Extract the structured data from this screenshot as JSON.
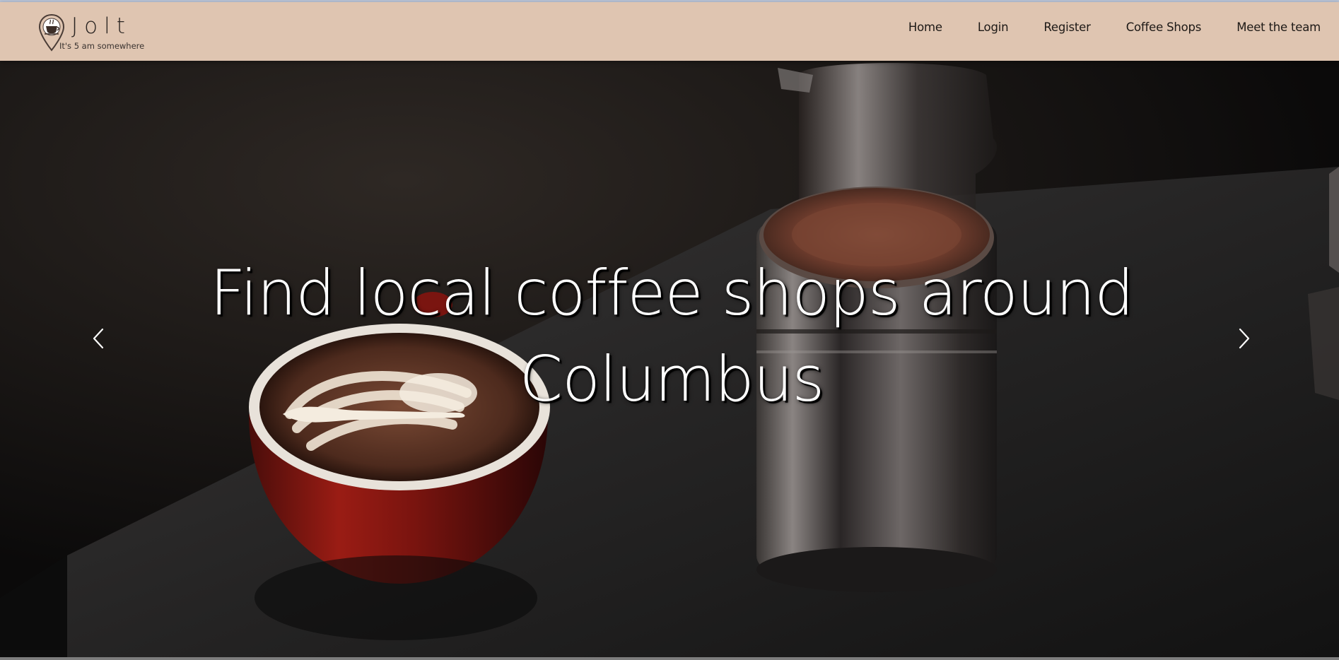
{
  "brand": {
    "name": "Jolt",
    "tagline": "It's 5 am somewhere",
    "logo_icon": "map-pin-coffee-cup-icon"
  },
  "nav": {
    "items": [
      {
        "label": "Home"
      },
      {
        "label": "Login"
      },
      {
        "label": "Register"
      },
      {
        "label": "Coffee Shops"
      },
      {
        "label": "Meet the team"
      }
    ]
  },
  "hero": {
    "headline_line1": "Find local coffee shops around",
    "headline_line2": "Columbus",
    "prev_icon": "chevron-left-icon",
    "next_icon": "chevron-right-icon"
  },
  "colors": {
    "navbar_bg": "#dfc5b1",
    "nav_text": "#1d1916",
    "headline_text": "#ffffff"
  }
}
